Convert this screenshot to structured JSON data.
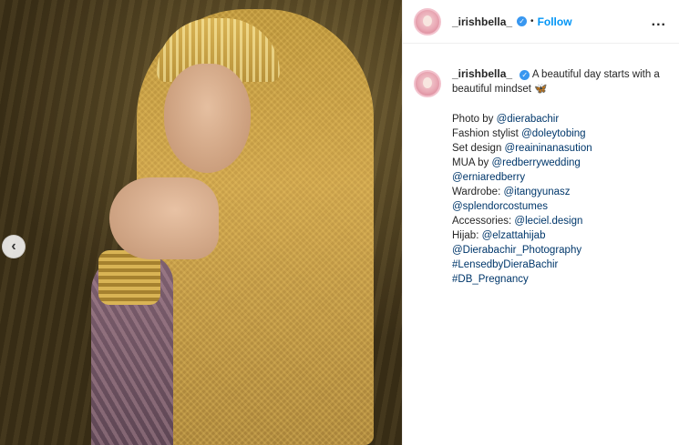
{
  "post": {
    "username": "_irishbella_",
    "follow_label": "Follow",
    "more_glyph": "...",
    "dot": "•",
    "carousel_prev_glyph": "‹",
    "caption_text": "A beautiful day starts with a beautiful mindset",
    "caption_emoji": "🦋",
    "credits": [
      {
        "label": "Photo by ",
        "mention": "@dierabachir"
      },
      {
        "label": "Fashion stylist ",
        "mention": "@doleytobing"
      },
      {
        "label": "Set design ",
        "mention": "@reaininanasution"
      },
      {
        "label": "MUA by ",
        "mention": "@redberrywedding"
      },
      {
        "label": "",
        "mention": "@erniaredberry"
      },
      {
        "label": "Wardrobe: ",
        "mention": "@itangyunasz"
      },
      {
        "label": "",
        "mention": "@splendorcostumes"
      },
      {
        "label": "Accessories: ",
        "mention": "@leciel.design"
      },
      {
        "label": "Hijab: ",
        "mention": "@elzattahijab"
      },
      {
        "label": "",
        "mention": "@Dierabachir_Photography"
      },
      {
        "label": "",
        "mention": "#LensedbyDieraBachir"
      },
      {
        "label": "",
        "mention": "#DB_Pregnancy"
      }
    ]
  },
  "icons": {
    "verified": "verified-badge-icon",
    "more": "more-options-icon",
    "carousel": "chevron-left-icon"
  },
  "colors": {
    "follow": "#0095f6",
    "verified": "#3897f0",
    "mention": "#00376b"
  }
}
